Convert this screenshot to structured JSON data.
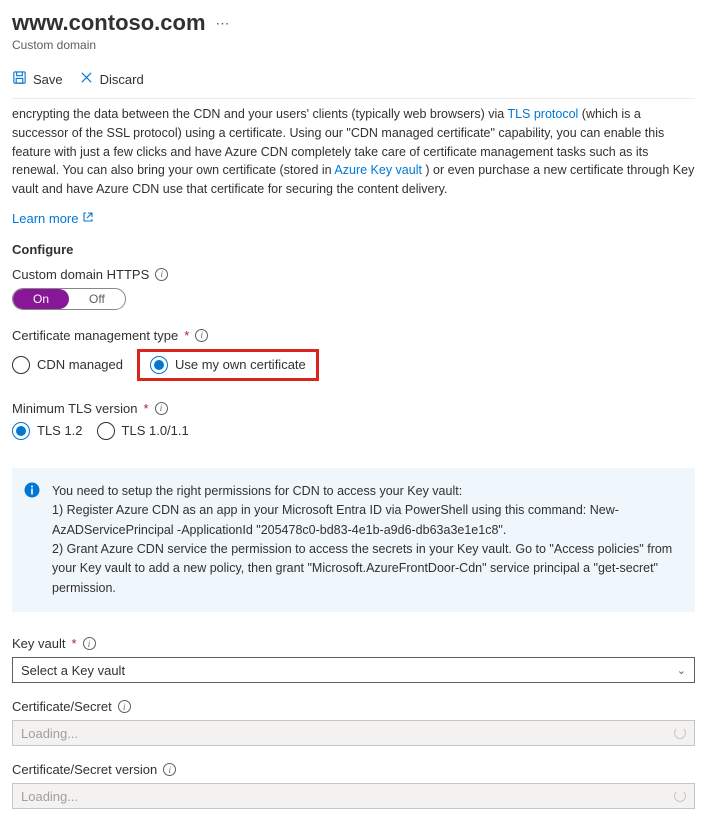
{
  "header": {
    "title": "www.contoso.com",
    "subtitle": "Custom domain"
  },
  "toolbar": {
    "save_label": "Save",
    "discard_label": "Discard"
  },
  "description": {
    "line1_pre": "encrypting the data between the CDN and your users' clients (typically web browsers) via ",
    "tls_link": "TLS protocol",
    "line1_post": " (which is a successor of the SSL protocol) using a certificate. Using our \"CDN managed certificate\" capability, you can enable this feature with just a few clicks and have Azure CDN completely take care of certificate management tasks such as its renewal. You can also bring your own certificate (stored in ",
    "akv_link": "Azure Key vault",
    "line1_end": " ) or even purchase a new certificate through Key vault and have Azure CDN use that certificate for securing the content delivery.",
    "learn_more": "Learn more"
  },
  "configure": {
    "heading": "Configure",
    "https_label": "Custom domain HTTPS",
    "toggle_on": "On",
    "toggle_off": "Off",
    "cert_type_label": "Certificate management type",
    "cert_opt_cdn": "CDN managed",
    "cert_opt_own": "Use my own certificate",
    "tls_label": "Minimum TLS version",
    "tls_opt_12": "TLS 1.2",
    "tls_opt_10": "TLS 1.0/1.1"
  },
  "info_panel": {
    "intro": "You need to setup the right permissions for CDN to access your Key vault:",
    "step1": "1) Register Azure CDN as an app in your Microsoft Entra ID via PowerShell using this command: New-AzADServicePrincipal -ApplicationId \"205478c0-bd83-4e1b-a9d6-db63a3e1e1c8\".",
    "step2": "2) Grant Azure CDN service the permission to access the secrets in your Key vault. Go to \"Access policies\" from your Key vault to add a new policy, then grant \"Microsoft.AzureFrontDoor-Cdn\" service principal a \"get-secret\" permission."
  },
  "fields": {
    "keyvault_label": "Key vault",
    "keyvault_placeholder": "Select a Key vault",
    "cert_label": "Certificate/Secret",
    "cert_loading": "Loading...",
    "version_label": "Certificate/Secret version",
    "version_loading": "Loading..."
  }
}
